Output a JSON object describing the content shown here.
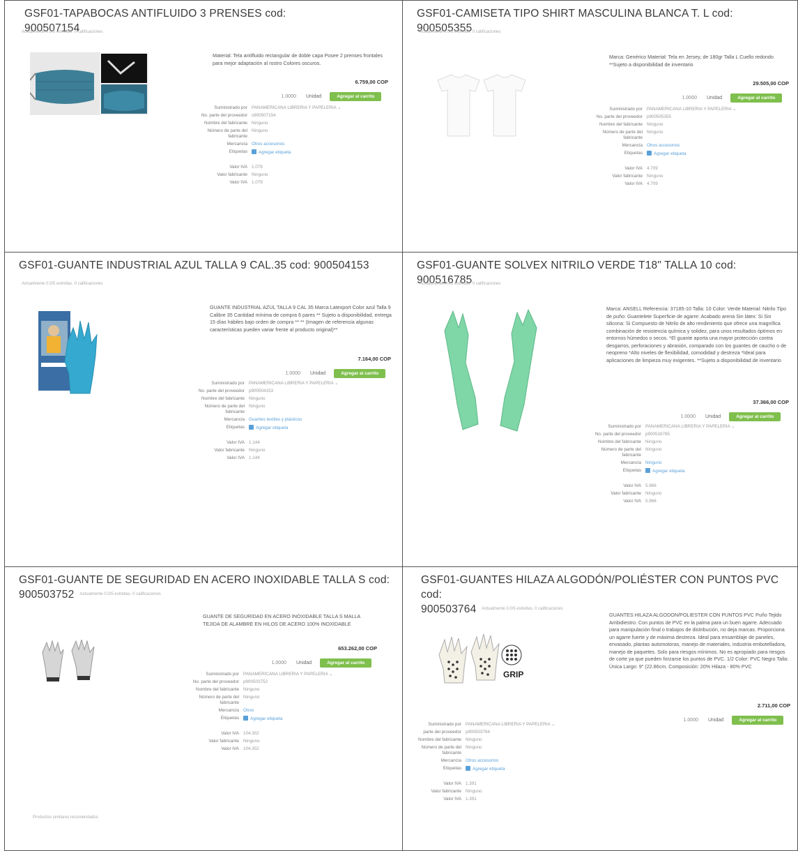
{
  "products": [
    {
      "title": "GSF01-TAPABOCAS ANTIFLUIDO 3 PRENSES cod: 900507154",
      "rating": "Actualmente 0.0/5 estrellas. 0 calificaciones",
      "description": "Material: Tela antifluido rectangular de doble capa Posee 2 prenses frontales para mejor adaptación al rostro Colores oscuros.",
      "price": "6.759,00 COP",
      "qty": "1.0000",
      "unit": "Unidad",
      "cart_button": "Agregar al carrito",
      "details": [
        {
          "label": "Suministrado por",
          "value": "PANAMERICANA LIBRERIA Y PAPELERIA ⌄",
          "link": false
        },
        {
          "label": "No. parte del proveedor",
          "value": "s900507154",
          "link": false
        },
        {
          "label": "Nombre del fabricante",
          "value": "Ninguno",
          "link": false
        },
        {
          "label": "Número de parte del fabricante",
          "value": "Ninguno",
          "link": false
        },
        {
          "label": "Mercancía",
          "value": "Otros accesorios",
          "link": true
        },
        {
          "label": "Etiquetas",
          "value": "Agregar etiqueta",
          "link": true,
          "icon": true
        },
        {
          "label": "Valor IVA",
          "value": "1.079",
          "link": false,
          "gap": true
        },
        {
          "label": "Valor fabricante",
          "value": "Ninguno",
          "link": false
        },
        {
          "label": "Valor IVA",
          "value": "1.079",
          "link": false
        }
      ]
    },
    {
      "title": "GSF01-CAMISETA TIPO SHIRT MASCULINA BLANCA T. L cod: 900505355",
      "rating": "Actualmente 0.0/5 estrellas. 0 calificaciones",
      "description": "Marca: Genérico Material: Tela en Jersey, de 180gr Talla L Cuello redondo **Sujeto a disponibilidad de inventario",
      "price": "29.505,00 COP",
      "qty": "1.0000",
      "unit": "Unidad",
      "cart_button": "Agregar al carrito",
      "details": [
        {
          "label": "Suministrado por",
          "value": "PANAMERICANA LIBRERIA Y PAPELERIA ⌄",
          "link": false
        },
        {
          "label": "No. parte del proveedor",
          "value": "p900505355",
          "link": false
        },
        {
          "label": "Nombre del fabricante",
          "value": "Ninguno",
          "link": false
        },
        {
          "label": "Número de parte del fabricante",
          "value": "Ninguno",
          "link": false
        },
        {
          "label": "Mercancía",
          "value": "Otros accesorios",
          "link": true
        },
        {
          "label": "Etiquetas",
          "value": "Agregar etiqueta",
          "link": true,
          "icon": true
        },
        {
          "label": "Valor IVA",
          "value": "4.709",
          "link": false,
          "gap": true
        },
        {
          "label": "Valor fabricante",
          "value": "Ninguno",
          "link": false
        },
        {
          "label": "Valor IVA",
          "value": "4.709",
          "link": false
        }
      ]
    },
    {
      "title": "GSF01-GUANTE INDUSTRIAL AZUL TALLA 9 CAL.35 cod: 900504153",
      "rating": "Actualmente 0.0/5 estrellas. 0 calificaciones",
      "description": "GUANTE INDUSTRIAL AZUL TALLA 9 CAL 35 Marca Latexport Color azul Talla 9 Calibre 35 Cantidad mínima de compra 6 pares ** Sujeto a disponibilidad, entrega 15 días hábiles bajo orden de compra ** ** (Imagen de referencia algunas características pueden variar frente al producto original)**",
      "price": "7.164,00 COP",
      "qty": "1.0000",
      "unit": "Unidad",
      "cart_button": "Agregar al carrito",
      "details": [
        {
          "label": "Suministrado por",
          "value": "PANAMERICANA LIBRERIA Y PAPELERIA ⌄",
          "link": false
        },
        {
          "label": "No. parte del proveedor",
          "value": "p900504153",
          "link": false
        },
        {
          "label": "Nombre del fabricante",
          "value": "Ninguno",
          "link": false
        },
        {
          "label": "Número de parte del fabricante",
          "value": "Ninguno",
          "link": false
        },
        {
          "label": "Mercancía",
          "value": "Guantes textiles y plásticos",
          "link": true
        },
        {
          "label": "Etiquetas",
          "value": "Agregar etiqueta",
          "link": true,
          "icon": true
        },
        {
          "label": "Valor IVA",
          "value": "1.144",
          "link": false,
          "gap": true
        },
        {
          "label": "Valor fabricante",
          "value": "Ninguno",
          "link": false
        },
        {
          "label": "Valor IVA",
          "value": "1.144",
          "link": false
        }
      ]
    },
    {
      "title": "GSF01-GUANTE SOLVEX NITRILO VERDE T18\" TALLA 10 cod: 900516785",
      "rating": "Actualmente 0.0/5 estrellas. 0 calificaciones",
      "description": "Marca: ANSELL Referencia: 37185-10 Talla: 10 Color: Verde Material: Nitrilo Tipo de puño: Guantelete Superficie de agarre: Acabado arena Sin látex: Si Sin silicona: Si Compuesto de Nitrilo de alto rendimiento que ofrece una magnífica combinación de resistencia química y solidez, para unos resultados óptimos en entornos húmedos o secos. *El guante aporta una mayor protección contra desgarros, perforaciones y abrasión, comparado con los guantes de caucho o de neopreno *Alto niveles de flexibilidad, comodidad y destreza *Ideal para aplicaciones de limpieza muy exigentes. **Sujeto a disponibilidad de inventario",
      "price": "37.366,00 COP",
      "qty": "1.0000",
      "unit": "Unidad",
      "cart_button": "Agregar al carrito",
      "details": [
        {
          "label": "Suministrado por",
          "value": "PANAMERICANA LIBRERIA Y PAPELERIA ⌄",
          "link": false
        },
        {
          "label": "No. parte del proveedor",
          "value": "p900516785",
          "link": false
        },
        {
          "label": "Nombre del fabricante",
          "value": "Ninguno",
          "link": false
        },
        {
          "label": "Número de parte del fabricante",
          "value": "Ninguno",
          "link": false
        },
        {
          "label": "Mercancía",
          "value": "Ninguno",
          "link": true
        },
        {
          "label": "Etiquetas",
          "value": "Agregar etiqueta",
          "link": true,
          "icon": true
        },
        {
          "label": "Valor IVA",
          "value": "5.966",
          "link": false,
          "gap": true
        },
        {
          "label": "Valor fabricante",
          "value": "Ninguno",
          "link": false
        },
        {
          "label": "Valor IVA",
          "value": "5.966",
          "link": false
        }
      ]
    },
    {
      "title_line1": "GSF01-GUANTE DE SEGURIDAD EN ACERO INOXIDABLE TALLA S cod:",
      "title_line2": "900503752",
      "rating": "Actualmente 0.0/5 estrellas. 0 calificaciones",
      "description": "GUANTE DE SEGURIDAD EN ACERO INOXIDABLE TALLA S MALLA TEJIDA DE ALAMBRE EN HILOS DE ACERO 100% INOXIDABLE",
      "price": "653.262,00 COP",
      "qty": "1.0000",
      "unit": "Unidad",
      "cart_button": "Agregar al carrito",
      "details": [
        {
          "label": "Suministrado por",
          "value": "PANAMERICANA LIBRERIA Y PAPELERIA ⌄",
          "link": false
        },
        {
          "label": "No. parte del proveedor",
          "value": "p900503752",
          "link": false
        },
        {
          "label": "Nombre del fabricante",
          "value": "Ninguno",
          "link": false
        },
        {
          "label": "Número de parte del fabricante",
          "value": "Ninguno",
          "link": false
        },
        {
          "label": "Mercancía",
          "value": "Otros",
          "link": true
        },
        {
          "label": "Etiquetas",
          "value": "Agregar etiqueta",
          "link": true,
          "icon": true
        },
        {
          "label": "Valor IVA",
          "value": "104.302",
          "link": false,
          "gap": true
        },
        {
          "label": "Valor fabricante",
          "value": "Ninguno",
          "link": false
        },
        {
          "label": "Valor IVA",
          "value": "104.302",
          "link": false
        }
      ],
      "footnote": "Productos similares recomendados"
    },
    {
      "title_line1": "GSF01-GUANTES HILAZA ALGODÓN/POLIÉSTER CON PUNTOS PVC cod:",
      "title_line2": "900503764",
      "rating": "Actualmente 0.0/5 estrellas. 0 calificaciones",
      "description": "GUANTES HILAZA ALGODON/POLIESTER CON PUNTOS PVC Puño Tejido Ambidiestro. Con puntos de PVC en la palma para un buen agarre. Adecuado para manipulación final o trabajos de distribución, no deja marcas. Proporciona un agarre fuerte y de máxima destreza. Ideal para ensamblaje de paneles, envasado, plantas automotoras, manejo de materiales, industria embotelladora, manejo de paquetes. Solo para riesgos mínimos. No es apropiado para riesgos de corte ya que pueden forzarse los puntos de PVC. 1/2 Color: PVC Negro Talla: Única Largo: 9\" (22.86cm. Composición: 20% Hilaza - 80% PVC",
      "price": "2.711,00 COP",
      "qty": "1.0000",
      "unit": "Unidad",
      "cart_button": "Agregar al carrito",
      "grip_label": "GRIP",
      "details": [
        {
          "label": "Suministrado por",
          "value": "PANAMERICANA LIBRERIA Y PAPELERIA ⌄",
          "link": false
        },
        {
          "label": "parte del proveedor",
          "value": "p900503764",
          "link": false
        },
        {
          "label": "Nombre del fabricante",
          "value": "Ninguno",
          "link": false
        },
        {
          "label": "Número de parte del fabricante",
          "value": "Ninguno",
          "link": false
        },
        {
          "label": "Mercancía",
          "value": "Otros accesorios",
          "link": true
        },
        {
          "label": "Etiquetas",
          "value": "Agregar etiqueta",
          "link": true,
          "icon": true
        },
        {
          "label": "Valor IVA",
          "value": "1.391",
          "link": false,
          "gap": true
        },
        {
          "label": "Valor fabricante",
          "value": "Ninguno",
          "link": false
        },
        {
          "label": "Valor IVA",
          "value": "1.391",
          "link": false
        }
      ]
    }
  ],
  "colors": {
    "cart_button": "#7fbf4d",
    "link": "#5aa0d8",
    "mask_blue": "#3d7f96",
    "glove_blue": "#35a9cf",
    "glove_green": "#7fd6a7"
  }
}
